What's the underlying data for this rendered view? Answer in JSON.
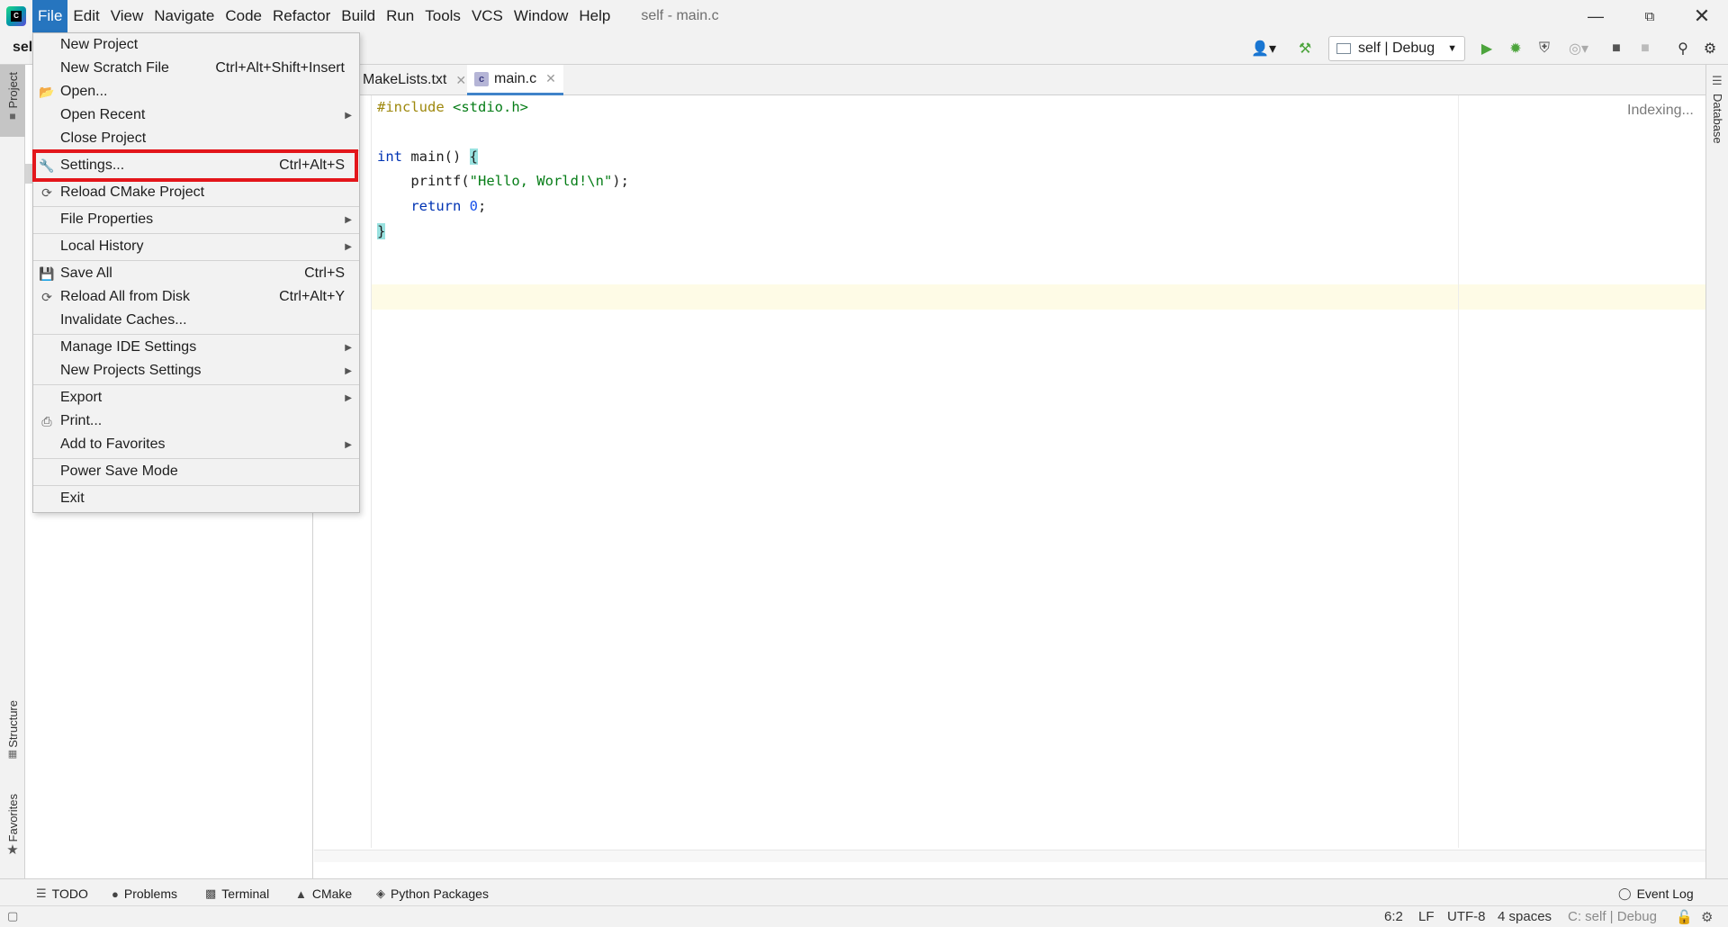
{
  "window": {
    "title": "self - main.c"
  },
  "menubar": {
    "items": [
      "File",
      "Edit",
      "View",
      "Navigate",
      "Code",
      "Refactor",
      "Build",
      "Run",
      "Tools",
      "VCS",
      "Window",
      "Help"
    ]
  },
  "toolbar": {
    "project_crumb": "sel",
    "run_config": "self | Debug"
  },
  "left_stripe": {
    "project": "Project",
    "structure": "Structure",
    "favorites": "Favorites"
  },
  "right_stripe": {
    "database": "Database"
  },
  "editor": {
    "tabs": [
      {
        "label": "MakeLists.txt",
        "active": false
      },
      {
        "label": "main.c",
        "active": true
      }
    ],
    "status_text": "Indexing..."
  },
  "code": {
    "line1_directive": "#include",
    "line1_header": "<stdio.h>",
    "line3_type": "int",
    "line3_rest": " main() ",
    "line3_brace": "{",
    "line4_fn": "printf(",
    "line4_str": "\"Hello, World!\\n\"",
    "line4_end": ");",
    "line5_kw": "return",
    "line5_num": "0",
    "line5_end": ";",
    "line6_brace": "}"
  },
  "file_menu": {
    "items": [
      {
        "label": "New Project",
        "shortcut": "",
        "submenu": false
      },
      {
        "label": "New Scratch File",
        "shortcut": "Ctrl+Alt+Shift+Insert",
        "submenu": false
      },
      {
        "label": "Open...",
        "shortcut": "",
        "submenu": false
      },
      {
        "label": "Open Recent",
        "shortcut": "",
        "submenu": true
      },
      {
        "label": "Close Project",
        "shortcut": "",
        "submenu": false
      },
      {
        "label": "Settings...",
        "shortcut": "Ctrl+Alt+S",
        "submenu": false,
        "highlighted": true
      },
      {
        "label": "Reload CMake Project",
        "shortcut": "",
        "submenu": false
      },
      {
        "label": "File Properties",
        "shortcut": "",
        "submenu": true
      },
      {
        "label": "Local History",
        "shortcut": "",
        "submenu": true
      },
      {
        "label": "Save All",
        "shortcut": "Ctrl+S",
        "submenu": false
      },
      {
        "label": "Reload All from Disk",
        "shortcut": "Ctrl+Alt+Y",
        "submenu": false
      },
      {
        "label": "Invalidate Caches...",
        "shortcut": "",
        "submenu": false
      },
      {
        "label": "Manage IDE Settings",
        "shortcut": "",
        "submenu": true
      },
      {
        "label": "New Projects Settings",
        "shortcut": "",
        "submenu": true
      },
      {
        "label": "Export",
        "shortcut": "",
        "submenu": true
      },
      {
        "label": "Print...",
        "shortcut": "",
        "submenu": false
      },
      {
        "label": "Add to Favorites",
        "shortcut": "",
        "submenu": true
      },
      {
        "label": "Power Save Mode",
        "shortcut": "",
        "submenu": false
      },
      {
        "label": "Exit",
        "shortcut": "",
        "submenu": false
      }
    ]
  },
  "bottom_tools": {
    "todo": "TODO",
    "problems": "Problems",
    "terminal": "Terminal",
    "cmake": "CMake",
    "python_packages": "Python Packages",
    "event_log": "Event Log"
  },
  "statusbar": {
    "position": "6:2",
    "line_sep": "LF",
    "encoding": "UTF-8",
    "indent": "4 spaces",
    "context": "C: self | Debug"
  },
  "colors": {
    "menu_active": "#2675bf",
    "highlight_box": "#e3161b",
    "run_green": "#4ca43c"
  }
}
